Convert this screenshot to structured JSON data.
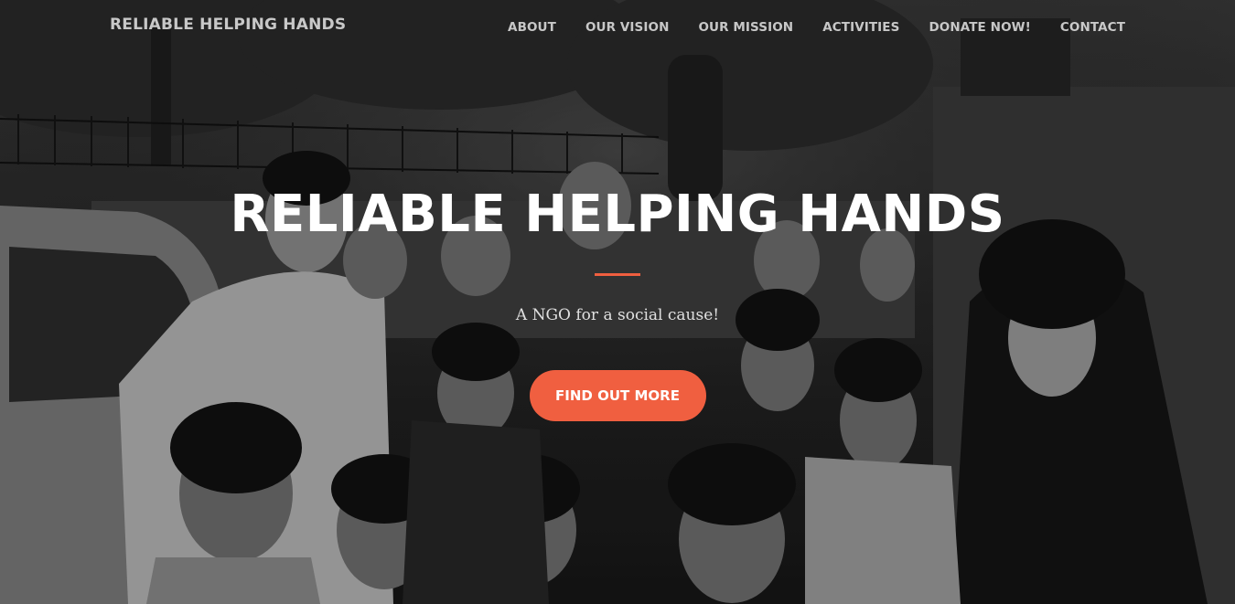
{
  "navbar": {
    "brand": "RELIABLE HELPING HANDS",
    "links": [
      {
        "label": "ABOUT"
      },
      {
        "label": "OUR VISION"
      },
      {
        "label": "OUR MISSION"
      },
      {
        "label": "ACTIVITIES"
      },
      {
        "label": "DONATE NOW!"
      },
      {
        "label": "CONTACT"
      }
    ]
  },
  "hero": {
    "title": "RELIABLE HELPING HANDS",
    "subtitle": "A NGO for a social cause!",
    "cta_label": "FIND OUT MORE",
    "background_image": "black-and-white-group-photo-icon"
  },
  "colors": {
    "accent": "#f05f40",
    "text": "#ffffff"
  }
}
